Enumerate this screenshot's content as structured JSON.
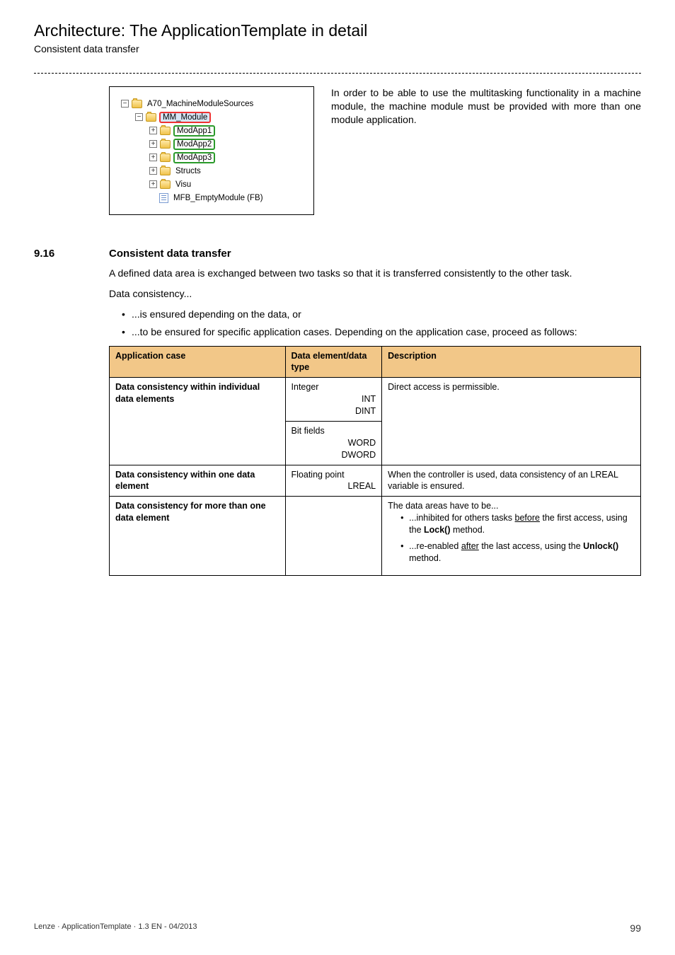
{
  "header": {
    "title": "Architecture: The ApplicationTemplate in detail",
    "subtitle": "Consistent data transfer"
  },
  "tree": {
    "items": [
      {
        "label": "A70_MachineModuleSources"
      },
      {
        "label": "MM_Module"
      },
      {
        "label": "ModApp1"
      },
      {
        "label": "ModApp2"
      },
      {
        "label": "ModApp3"
      },
      {
        "label": "Structs"
      },
      {
        "label": "Visu"
      },
      {
        "label": "MFB_EmptyModule (FB)"
      }
    ]
  },
  "sideParagraph": "In order to be able to use the multitasking functionality in a machine module, the machine module must be provided with more than one module application.",
  "section": {
    "number": "9.16",
    "title": "Consistent data transfer",
    "p1": "A defined data area is exchanged between two tasks so that it is transferred consistently to the other task.",
    "p2": "Data consistency...",
    "bullets": [
      "...is ensured depending on the data, or",
      "...to be ensured for specific application cases. Depending on the application case, proceed as follows:"
    ]
  },
  "table": {
    "headers": [
      "Application case",
      "Data element/data type",
      "Description"
    ],
    "rows": [
      {
        "c0": "Data consistency within individual data elements",
        "c1a": "Integer",
        "c1b": "INT",
        "c1c": "DINT",
        "c2": "Direct access is permissible."
      },
      {
        "c1a": "Bit fields",
        "c1b": "WORD",
        "c1c": "DWORD"
      },
      {
        "c0": "Data consistency within one data element",
        "c1a": "Floating point",
        "c1b": "LREAL",
        "c2": "When the controller is used, data consistency of an LREAL variable is ensured."
      },
      {
        "c0": "Data consistency for more than one data element",
        "c2a": "The data areas have to be...",
        "b1a": "...inhibited for others tasks ",
        "b1u": "before",
        "b1b": " the first access, using the ",
        "b1bold": "Lock()",
        "b1c": " method.",
        "b2a": "...re-enabled ",
        "b2u": "after",
        "b2b": " the last access, using the ",
        "b2bold": "Unlock()",
        "b2c": " method."
      }
    ]
  },
  "footer": {
    "left": "Lenze · ApplicationTemplate · 1.3 EN - 04/2013",
    "page": "99"
  }
}
